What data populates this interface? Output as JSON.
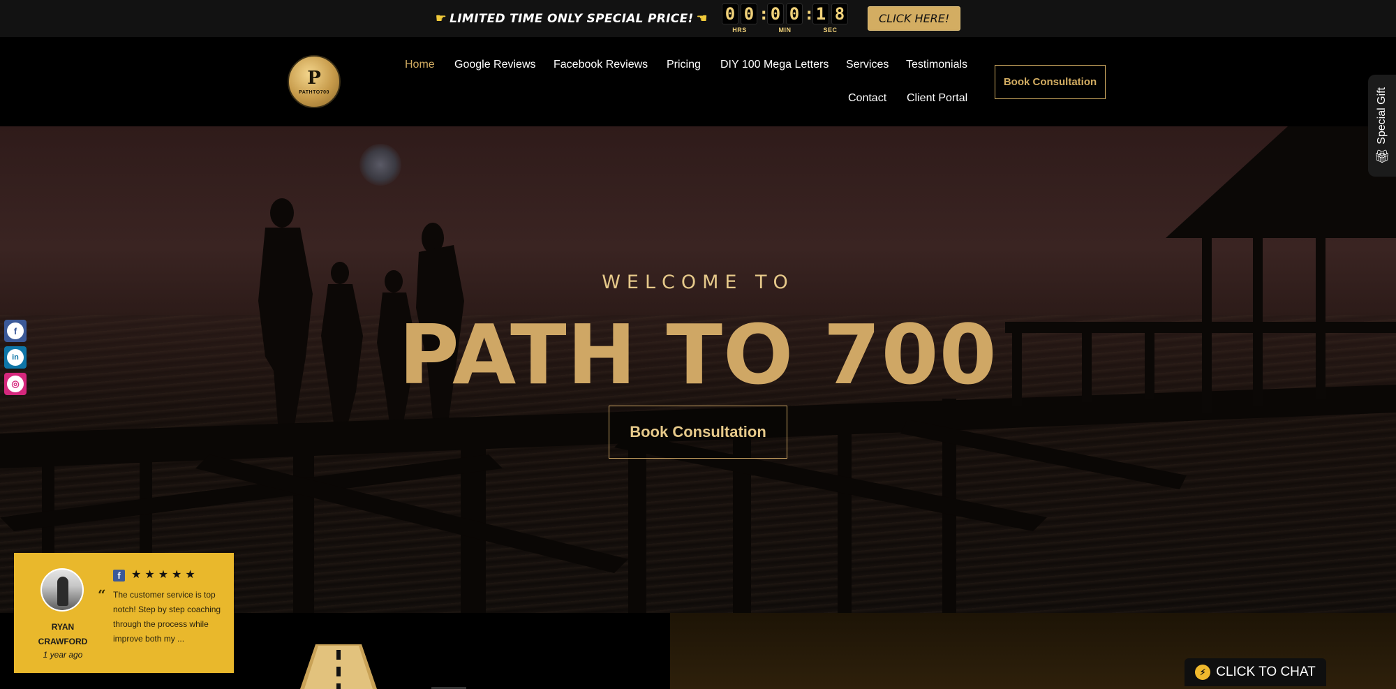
{
  "promo": {
    "text": "LIMITED TIME ONLY SPECIAL PRICE!",
    "left_icon": "pointing-hand-right-icon",
    "right_icon": "pointing-hand-left-icon",
    "timer": {
      "hours": [
        "0",
        "0"
      ],
      "minutes": [
        "0",
        "0"
      ],
      "seconds": [
        "1",
        "8"
      ],
      "hours_label": "HRS",
      "minutes_label": "MIN",
      "seconds_label": "SEC"
    },
    "button_label": "CLICK HERE!"
  },
  "header": {
    "logo_mark": "P",
    "logo_text": "PATHTO700",
    "nav": [
      {
        "label": "Home",
        "active": true
      },
      {
        "label": "Google Reviews"
      },
      {
        "label": "Facebook Reviews"
      },
      {
        "label": "Pricing"
      },
      {
        "label": "DIY 100 Mega Letters"
      },
      {
        "label": "Services"
      },
      {
        "label": "Testimonials"
      },
      {
        "label": "Contact"
      },
      {
        "label": "Client Portal"
      }
    ],
    "cta_label": "Book Consultation"
  },
  "hero": {
    "welcome": "WELCOME TO",
    "title": "PATH TO 700",
    "cta_label": "Book Consultation"
  },
  "social": [
    {
      "name": "facebook",
      "icon": "facebook-icon",
      "glyph": "f",
      "color": "#3b5998"
    },
    {
      "name": "linkedin",
      "icon": "linkedin-icon",
      "glyph": "in",
      "color": "#0e76a8"
    },
    {
      "name": "instagram",
      "icon": "instagram-icon",
      "glyph": "◎",
      "color": "#d6287d"
    }
  ],
  "gift_tab": {
    "label": "Special Gift",
    "icon": "gift-icon"
  },
  "review": {
    "name_line1": "RYAN",
    "name_line2": "CRAWFORD",
    "time": "1 year ago",
    "stars": "★★★★★",
    "rating": 5,
    "source_icon": "facebook-icon",
    "text": "The customer service is top notch! Step by step coaching through the process while improve both my ..."
  },
  "chat": {
    "label": "CLICK TO CHAT",
    "icon": "messenger-icon"
  },
  "colors": {
    "gold": "#d3ad62",
    "hero_gold": "#cfa765",
    "review_bg": "#e9b82c",
    "promo_bg": "#121212"
  }
}
